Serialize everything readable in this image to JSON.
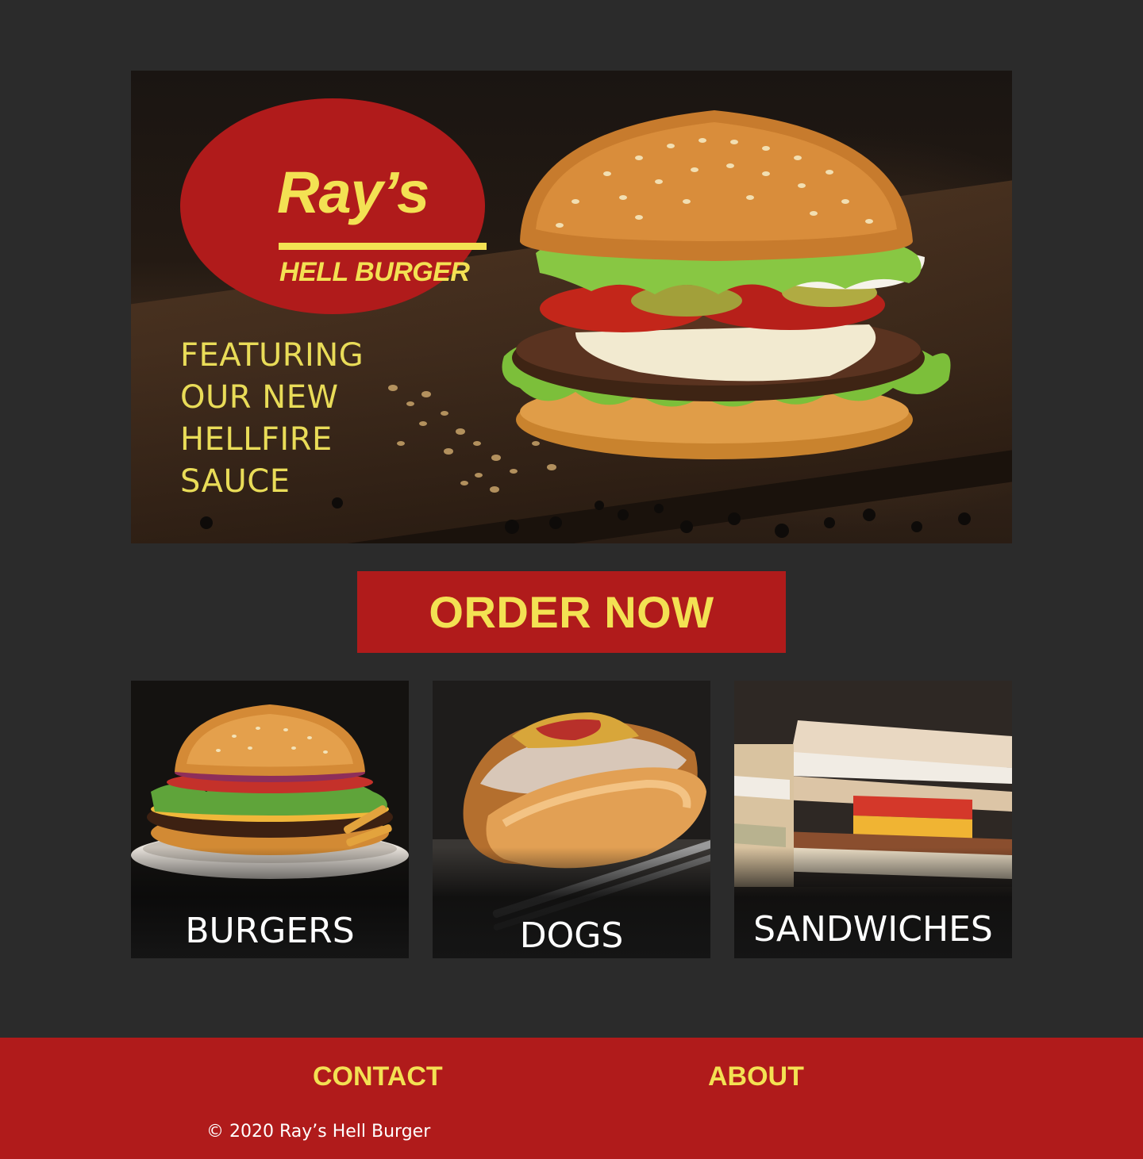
{
  "brand": {
    "name": "Ray’s",
    "tagline": "HELL BURGER",
    "colors": {
      "background": "#2b2b2b",
      "accent_red": "#b01b1b",
      "accent_yellow": "#f3e153"
    }
  },
  "hero": {
    "feature_lines": [
      "FEATURING",
      "OUR NEW",
      "HELLFIRE",
      "SAUCE"
    ],
    "image": "burger-photo"
  },
  "order_button": {
    "label": "ORDER NOW"
  },
  "categories": [
    {
      "label": "BURGERS",
      "image": "burger-photo"
    },
    {
      "label": "DOGS",
      "image": "hot-dog-photo"
    },
    {
      "label": "SANDWICHES",
      "image": "club-sandwich-photo"
    }
  ],
  "footer": {
    "links": [
      {
        "label": "CONTACT"
      },
      {
        "label": "ABOUT"
      }
    ],
    "copyright": "© 2020 Ray’s Hell Burger"
  }
}
